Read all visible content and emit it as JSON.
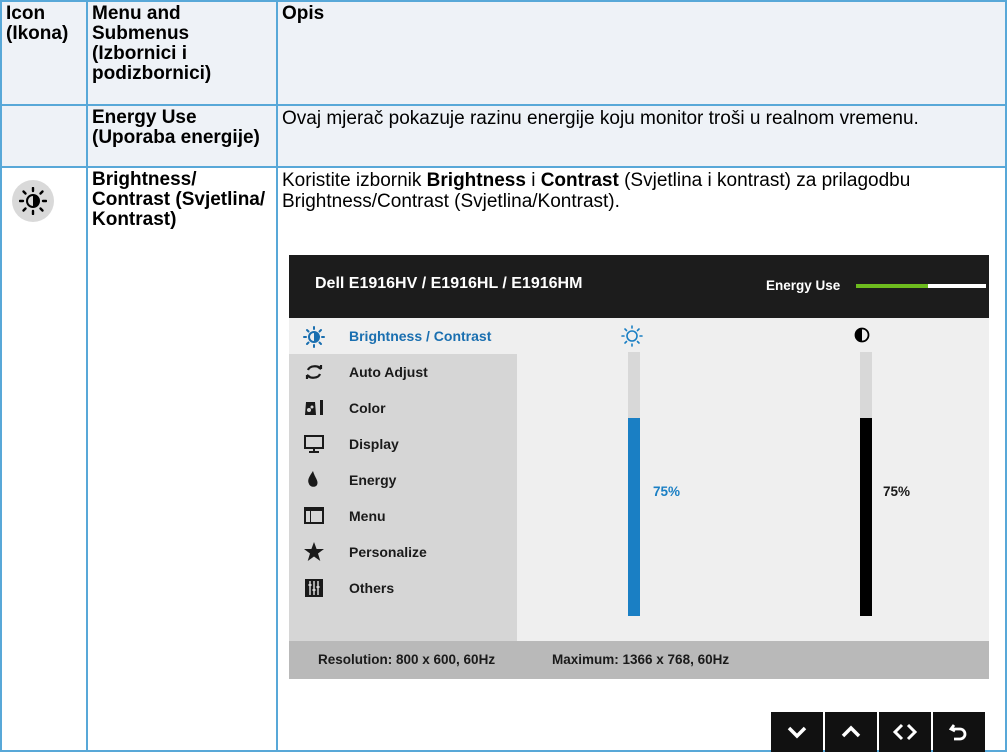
{
  "table": {
    "headers": {
      "icon": "Icon (Ikona)",
      "menu": "Menu and Submenus (Izbornici i podizbornici)",
      "desc": "Opis"
    },
    "rows": [
      {
        "menu": "Energy Use (Uporaba energije)",
        "desc": "Ovaj mjerač pokazuje razinu energije koju monitor troši u realnom vremenu."
      },
      {
        "menu": "Brightness/ Contrast (Svjetlina/ Kontrast)",
        "desc_pre": "Koristite izbornik ",
        "desc_b1": "Brightness",
        "desc_mid": " i ",
        "desc_b2": "Contrast",
        "desc_post": " (Svjetlina i kontrast) za prilagodbu Brightness/Contrast (Svjetlina/Kontrast).",
        "icon": "brightness-sun-icon"
      }
    ]
  },
  "osd": {
    "model": "Dell E1916HV / E1916HL / E1916HM",
    "energy_label": "Energy Use",
    "energy_level": 0.55,
    "menu": [
      {
        "label": "Brightness / Contrast",
        "icon": "brightness-icon",
        "active": true
      },
      {
        "label": "Auto Adjust",
        "icon": "auto-adjust-icon"
      },
      {
        "label": "Color",
        "icon": "color-icon"
      },
      {
        "label": "Display",
        "icon": "display-icon"
      },
      {
        "label": "Energy",
        "icon": "energy-icon"
      },
      {
        "label": "Menu",
        "icon": "menu-icon"
      },
      {
        "label": "Personalize",
        "icon": "star-icon"
      },
      {
        "label": "Others",
        "icon": "others-icon"
      }
    ],
    "brightness": {
      "value": 75,
      "label": "75%",
      "color": "#1a7fc4"
    },
    "contrast": {
      "value": 75,
      "label": "75%",
      "color": "#000000"
    },
    "footer": {
      "resolution": "Resolution: 800 x 600, 60Hz",
      "maximum": "Maximum: 1366 x 768, 60Hz"
    },
    "nav_buttons": [
      "down-icon",
      "up-icon",
      "left-right-icon",
      "back-icon"
    ]
  }
}
